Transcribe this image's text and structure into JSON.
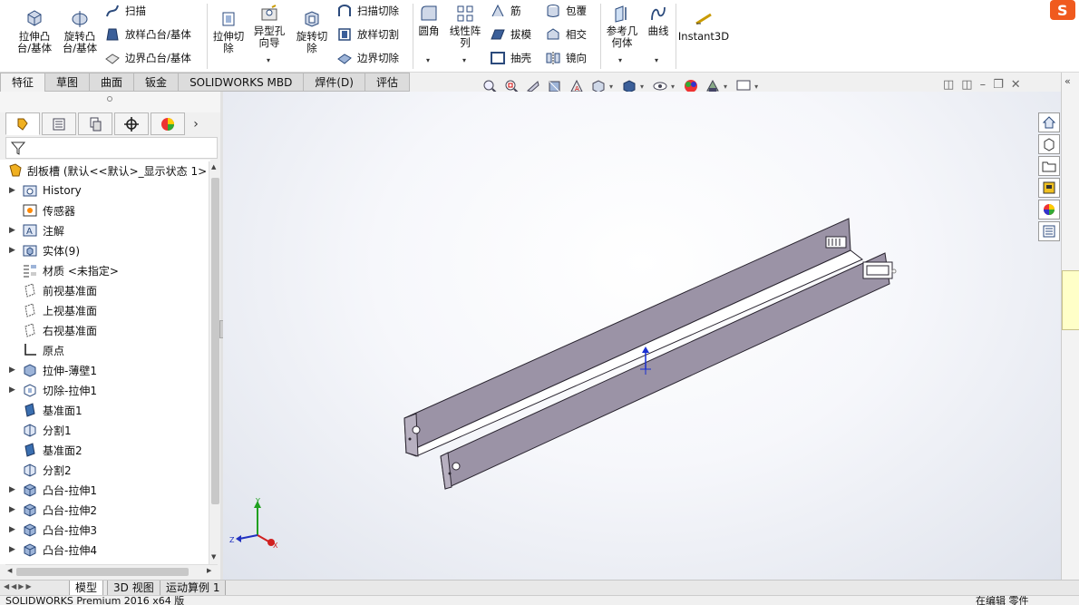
{
  "ribbon": {
    "extrude_boss": "拉伸凸\n台/基体",
    "revolve_boss": "旋转凸\n台/基体",
    "sweep": "扫描",
    "loft_boss": "放样凸台/基体",
    "boundary_boss": "边界凸台/基体",
    "extrude_cut": "拉伸切\n除",
    "hole_wizard": "异型孔\n向导",
    "revolve_cut": "旋转切\n除",
    "sweep_cut": "扫描切除",
    "loft_cut": "放样切割",
    "boundary_cut": "边界切除",
    "fillet": "圆角",
    "linear_pattern": "线性阵\n列",
    "rib": "筋",
    "draft": "拔模",
    "shell": "抽壳",
    "wrap": "包覆",
    "intersect": "相交",
    "mirror": "镜向",
    "ref_geometry": "参考几\n何体",
    "curves": "曲线",
    "instant3d": "Instant3D"
  },
  "tabs": [
    "特征",
    "草图",
    "曲面",
    "钣金",
    "SOLIDWORKS MBD",
    "焊件(D)",
    "评估"
  ],
  "tree": {
    "root": "刮板槽 (默认<<默认>_显示状态 1>",
    "items": [
      {
        "label": "History",
        "icon": "history-folder-icon",
        "expand": true
      },
      {
        "label": "传感器",
        "icon": "sensor-icon",
        "expand": false
      },
      {
        "label": "注解",
        "icon": "annotation-icon",
        "expand": true
      },
      {
        "label": "实体(9)",
        "icon": "solid-bodies-icon",
        "expand": true
      },
      {
        "label": "材质 <未指定>",
        "icon": "material-icon",
        "expand": false
      },
      {
        "label": "前视基准面",
        "icon": "plane-icon",
        "expand": false
      },
      {
        "label": "上视基准面",
        "icon": "plane-icon",
        "expand": false
      },
      {
        "label": "右视基准面",
        "icon": "plane-icon",
        "expand": false
      },
      {
        "label": "原点",
        "icon": "origin-icon",
        "expand": false
      },
      {
        "label": "拉伸-薄壁1",
        "icon": "extrude-feature-icon",
        "expand": true
      },
      {
        "label": "切除-拉伸1",
        "icon": "cut-feature-icon",
        "expand": true
      },
      {
        "label": "基准面1",
        "icon": "plane-solid-icon",
        "expand": false
      },
      {
        "label": "分割1",
        "icon": "split-icon",
        "expand": false
      },
      {
        "label": "基准面2",
        "icon": "plane-solid-icon",
        "expand": false
      },
      {
        "label": "分割2",
        "icon": "split-icon",
        "expand": false
      },
      {
        "label": "凸台-拉伸1",
        "icon": "boss-extrude-icon",
        "expand": true
      },
      {
        "label": "凸台-拉伸2",
        "icon": "boss-extrude-icon",
        "expand": true
      },
      {
        "label": "凸台-拉伸3",
        "icon": "boss-extrude-icon",
        "expand": true
      },
      {
        "label": "凸台-拉伸4",
        "icon": "boss-extrude-icon",
        "expand": true
      }
    ]
  },
  "bottom_tabs": [
    "模型",
    "3D 视图",
    "运动算例 1"
  ],
  "status": {
    "left": "SOLIDWORKS Premium 2016 x64 版",
    "right": "在编辑 零件"
  },
  "colors": {
    "part_face": "#9b93a6",
    "part_edge": "#2a2530",
    "triad_x": "#d02020",
    "triad_y": "#20a020",
    "triad_z": "#2030c0"
  }
}
